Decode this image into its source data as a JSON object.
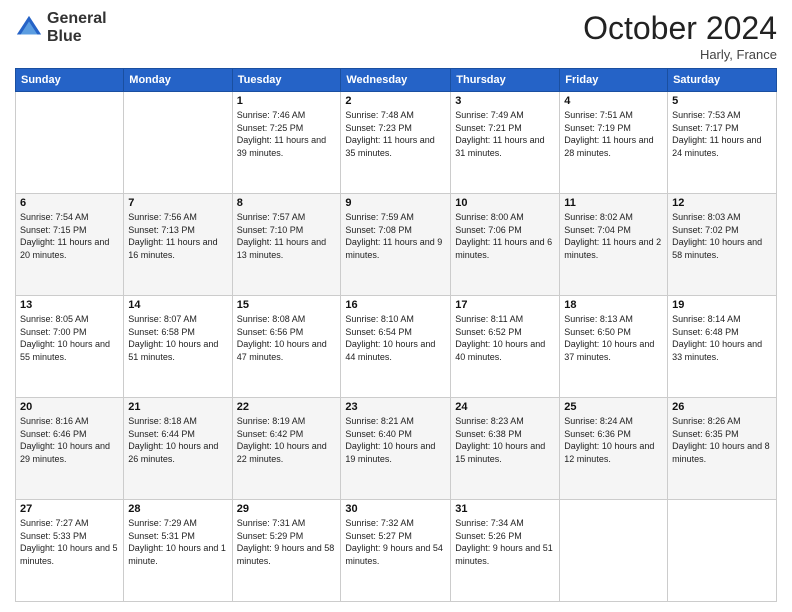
{
  "logo": {
    "line1": "General",
    "line2": "Blue"
  },
  "title": "October 2024",
  "location": "Harly, France",
  "weekdays": [
    "Sunday",
    "Monday",
    "Tuesday",
    "Wednesday",
    "Thursday",
    "Friday",
    "Saturday"
  ],
  "weeks": [
    [
      {
        "day": "",
        "sunrise": "",
        "sunset": "",
        "daylight": ""
      },
      {
        "day": "",
        "sunrise": "",
        "sunset": "",
        "daylight": ""
      },
      {
        "day": "1",
        "sunrise": "Sunrise: 7:46 AM",
        "sunset": "Sunset: 7:25 PM",
        "daylight": "Daylight: 11 hours and 39 minutes."
      },
      {
        "day": "2",
        "sunrise": "Sunrise: 7:48 AM",
        "sunset": "Sunset: 7:23 PM",
        "daylight": "Daylight: 11 hours and 35 minutes."
      },
      {
        "day": "3",
        "sunrise": "Sunrise: 7:49 AM",
        "sunset": "Sunset: 7:21 PM",
        "daylight": "Daylight: 11 hours and 31 minutes."
      },
      {
        "day": "4",
        "sunrise": "Sunrise: 7:51 AM",
        "sunset": "Sunset: 7:19 PM",
        "daylight": "Daylight: 11 hours and 28 minutes."
      },
      {
        "day": "5",
        "sunrise": "Sunrise: 7:53 AM",
        "sunset": "Sunset: 7:17 PM",
        "daylight": "Daylight: 11 hours and 24 minutes."
      }
    ],
    [
      {
        "day": "6",
        "sunrise": "Sunrise: 7:54 AM",
        "sunset": "Sunset: 7:15 PM",
        "daylight": "Daylight: 11 hours and 20 minutes."
      },
      {
        "day": "7",
        "sunrise": "Sunrise: 7:56 AM",
        "sunset": "Sunset: 7:13 PM",
        "daylight": "Daylight: 11 hours and 16 minutes."
      },
      {
        "day": "8",
        "sunrise": "Sunrise: 7:57 AM",
        "sunset": "Sunset: 7:10 PM",
        "daylight": "Daylight: 11 hours and 13 minutes."
      },
      {
        "day": "9",
        "sunrise": "Sunrise: 7:59 AM",
        "sunset": "Sunset: 7:08 PM",
        "daylight": "Daylight: 11 hours and 9 minutes."
      },
      {
        "day": "10",
        "sunrise": "Sunrise: 8:00 AM",
        "sunset": "Sunset: 7:06 PM",
        "daylight": "Daylight: 11 hours and 6 minutes."
      },
      {
        "day": "11",
        "sunrise": "Sunrise: 8:02 AM",
        "sunset": "Sunset: 7:04 PM",
        "daylight": "Daylight: 11 hours and 2 minutes."
      },
      {
        "day": "12",
        "sunrise": "Sunrise: 8:03 AM",
        "sunset": "Sunset: 7:02 PM",
        "daylight": "Daylight: 10 hours and 58 minutes."
      }
    ],
    [
      {
        "day": "13",
        "sunrise": "Sunrise: 8:05 AM",
        "sunset": "Sunset: 7:00 PM",
        "daylight": "Daylight: 10 hours and 55 minutes."
      },
      {
        "day": "14",
        "sunrise": "Sunrise: 8:07 AM",
        "sunset": "Sunset: 6:58 PM",
        "daylight": "Daylight: 10 hours and 51 minutes."
      },
      {
        "day": "15",
        "sunrise": "Sunrise: 8:08 AM",
        "sunset": "Sunset: 6:56 PM",
        "daylight": "Daylight: 10 hours and 47 minutes."
      },
      {
        "day": "16",
        "sunrise": "Sunrise: 8:10 AM",
        "sunset": "Sunset: 6:54 PM",
        "daylight": "Daylight: 10 hours and 44 minutes."
      },
      {
        "day": "17",
        "sunrise": "Sunrise: 8:11 AM",
        "sunset": "Sunset: 6:52 PM",
        "daylight": "Daylight: 10 hours and 40 minutes."
      },
      {
        "day": "18",
        "sunrise": "Sunrise: 8:13 AM",
        "sunset": "Sunset: 6:50 PM",
        "daylight": "Daylight: 10 hours and 37 minutes."
      },
      {
        "day": "19",
        "sunrise": "Sunrise: 8:14 AM",
        "sunset": "Sunset: 6:48 PM",
        "daylight": "Daylight: 10 hours and 33 minutes."
      }
    ],
    [
      {
        "day": "20",
        "sunrise": "Sunrise: 8:16 AM",
        "sunset": "Sunset: 6:46 PM",
        "daylight": "Daylight: 10 hours and 29 minutes."
      },
      {
        "day": "21",
        "sunrise": "Sunrise: 8:18 AM",
        "sunset": "Sunset: 6:44 PM",
        "daylight": "Daylight: 10 hours and 26 minutes."
      },
      {
        "day": "22",
        "sunrise": "Sunrise: 8:19 AM",
        "sunset": "Sunset: 6:42 PM",
        "daylight": "Daylight: 10 hours and 22 minutes."
      },
      {
        "day": "23",
        "sunrise": "Sunrise: 8:21 AM",
        "sunset": "Sunset: 6:40 PM",
        "daylight": "Daylight: 10 hours and 19 minutes."
      },
      {
        "day": "24",
        "sunrise": "Sunrise: 8:23 AM",
        "sunset": "Sunset: 6:38 PM",
        "daylight": "Daylight: 10 hours and 15 minutes."
      },
      {
        "day": "25",
        "sunrise": "Sunrise: 8:24 AM",
        "sunset": "Sunset: 6:36 PM",
        "daylight": "Daylight: 10 hours and 12 minutes."
      },
      {
        "day": "26",
        "sunrise": "Sunrise: 8:26 AM",
        "sunset": "Sunset: 6:35 PM",
        "daylight": "Daylight: 10 hours and 8 minutes."
      }
    ],
    [
      {
        "day": "27",
        "sunrise": "Sunrise: 7:27 AM",
        "sunset": "Sunset: 5:33 PM",
        "daylight": "Daylight: 10 hours and 5 minutes."
      },
      {
        "day": "28",
        "sunrise": "Sunrise: 7:29 AM",
        "sunset": "Sunset: 5:31 PM",
        "daylight": "Daylight: 10 hours and 1 minute."
      },
      {
        "day": "29",
        "sunrise": "Sunrise: 7:31 AM",
        "sunset": "Sunset: 5:29 PM",
        "daylight": "Daylight: 9 hours and 58 minutes."
      },
      {
        "day": "30",
        "sunrise": "Sunrise: 7:32 AM",
        "sunset": "Sunset: 5:27 PM",
        "daylight": "Daylight: 9 hours and 54 minutes."
      },
      {
        "day": "31",
        "sunrise": "Sunrise: 7:34 AM",
        "sunset": "Sunset: 5:26 PM",
        "daylight": "Daylight: 9 hours and 51 minutes."
      },
      {
        "day": "",
        "sunrise": "",
        "sunset": "",
        "daylight": ""
      },
      {
        "day": "",
        "sunrise": "",
        "sunset": "",
        "daylight": ""
      }
    ]
  ]
}
